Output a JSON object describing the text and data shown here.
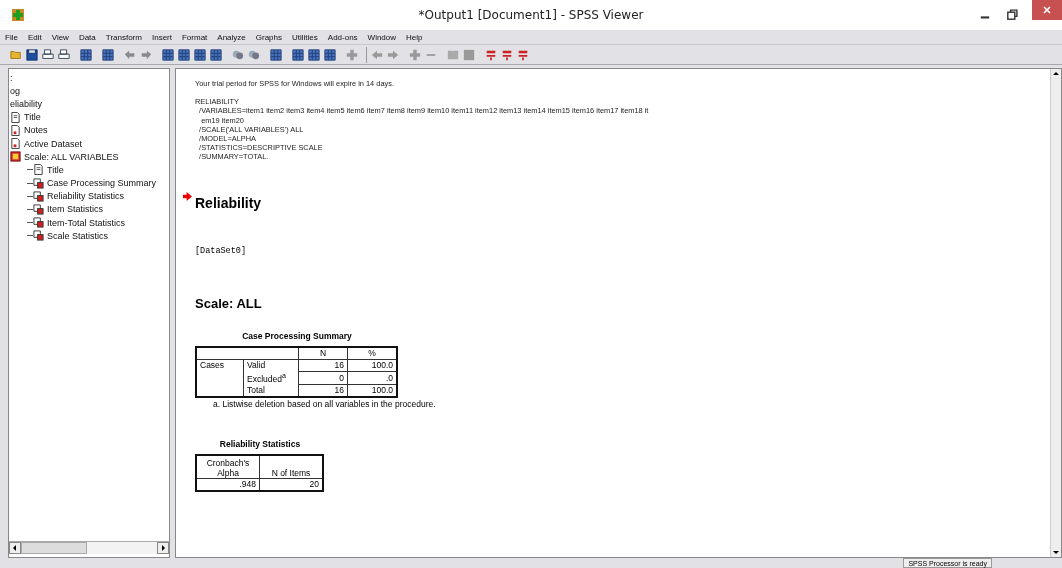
{
  "window": {
    "title": "*Output1 [Document1] - SPSS Viewer"
  },
  "menu": [
    "File",
    "Edit",
    "View",
    "Data",
    "Transform",
    "Insert",
    "Format",
    "Analyze",
    "Graphs",
    "Utilities",
    "Add-ons",
    "Window",
    "Help"
  ],
  "outline": [
    {
      "label": ":",
      "children": [
        {
          "label": "og"
        },
        {
          "label": "eliability",
          "children": [
            {
              "label": "Title",
              "kind": "title"
            },
            {
              "label": "Notes",
              "kind": "notes"
            },
            {
              "label": "Active Dataset",
              "kind": "notes"
            },
            {
              "label": "Scale: ALL VARIABLES",
              "kind": "folder",
              "children": [
                {
                  "label": "Title",
                  "kind": "title"
                },
                {
                  "label": "Case Processing Summary",
                  "kind": "table"
                },
                {
                  "label": "Reliability Statistics",
                  "kind": "table"
                },
                {
                  "label": "Item Statistics",
                  "kind": "table"
                },
                {
                  "label": "Item-Total Statistics",
                  "kind": "table"
                },
                {
                  "label": "Scale Statistics",
                  "kind": "table"
                }
              ]
            }
          ]
        }
      ]
    }
  ],
  "output": {
    "trial_notice": "Your trial period for SPSS for Windows will expire in 14 days.",
    "syntax": [
      "RELIABILITY",
      "  /VARIABLES=item1 item2 item3 item4 item5 item6 item7 item8 item9 item10 item11 item12 item13 item14 item15 item16 item17 item18 it",
      "   em19 item20",
      "  /SCALE('ALL VARIABLES') ALL",
      "  /MODEL=ALPHA",
      "  /STATISTICS=DESCRIPTIVE SCALE",
      "  /SUMMARY=TOTAL."
    ],
    "heading": "Reliability",
    "dataset": "[DataSet0]",
    "scale_heading": "Scale: ALL",
    "case_summary": {
      "title": "Case Processing Summary",
      "columns": [
        "N",
        "%"
      ],
      "group": "Cases",
      "rows": [
        {
          "label": "Valid",
          "values": [
            "16",
            "100.0"
          ]
        },
        {
          "label": "Excluded$^{a}$",
          "values": [
            "0",
            ".0"
          ]
        },
        {
          "label": "Total",
          "values": [
            "16",
            "100.0"
          ]
        }
      ],
      "footnote": "a. Listwise deletion based on all variables in the procedure."
    },
    "reliability": {
      "title": "Reliability Statistics",
      "columns": [
        "Cronbach's Alpha",
        "N of Items"
      ],
      "values": [
        ".948",
        "20"
      ]
    }
  },
  "status_bar": {
    "text": "SPSS  Processor is ready"
  }
}
